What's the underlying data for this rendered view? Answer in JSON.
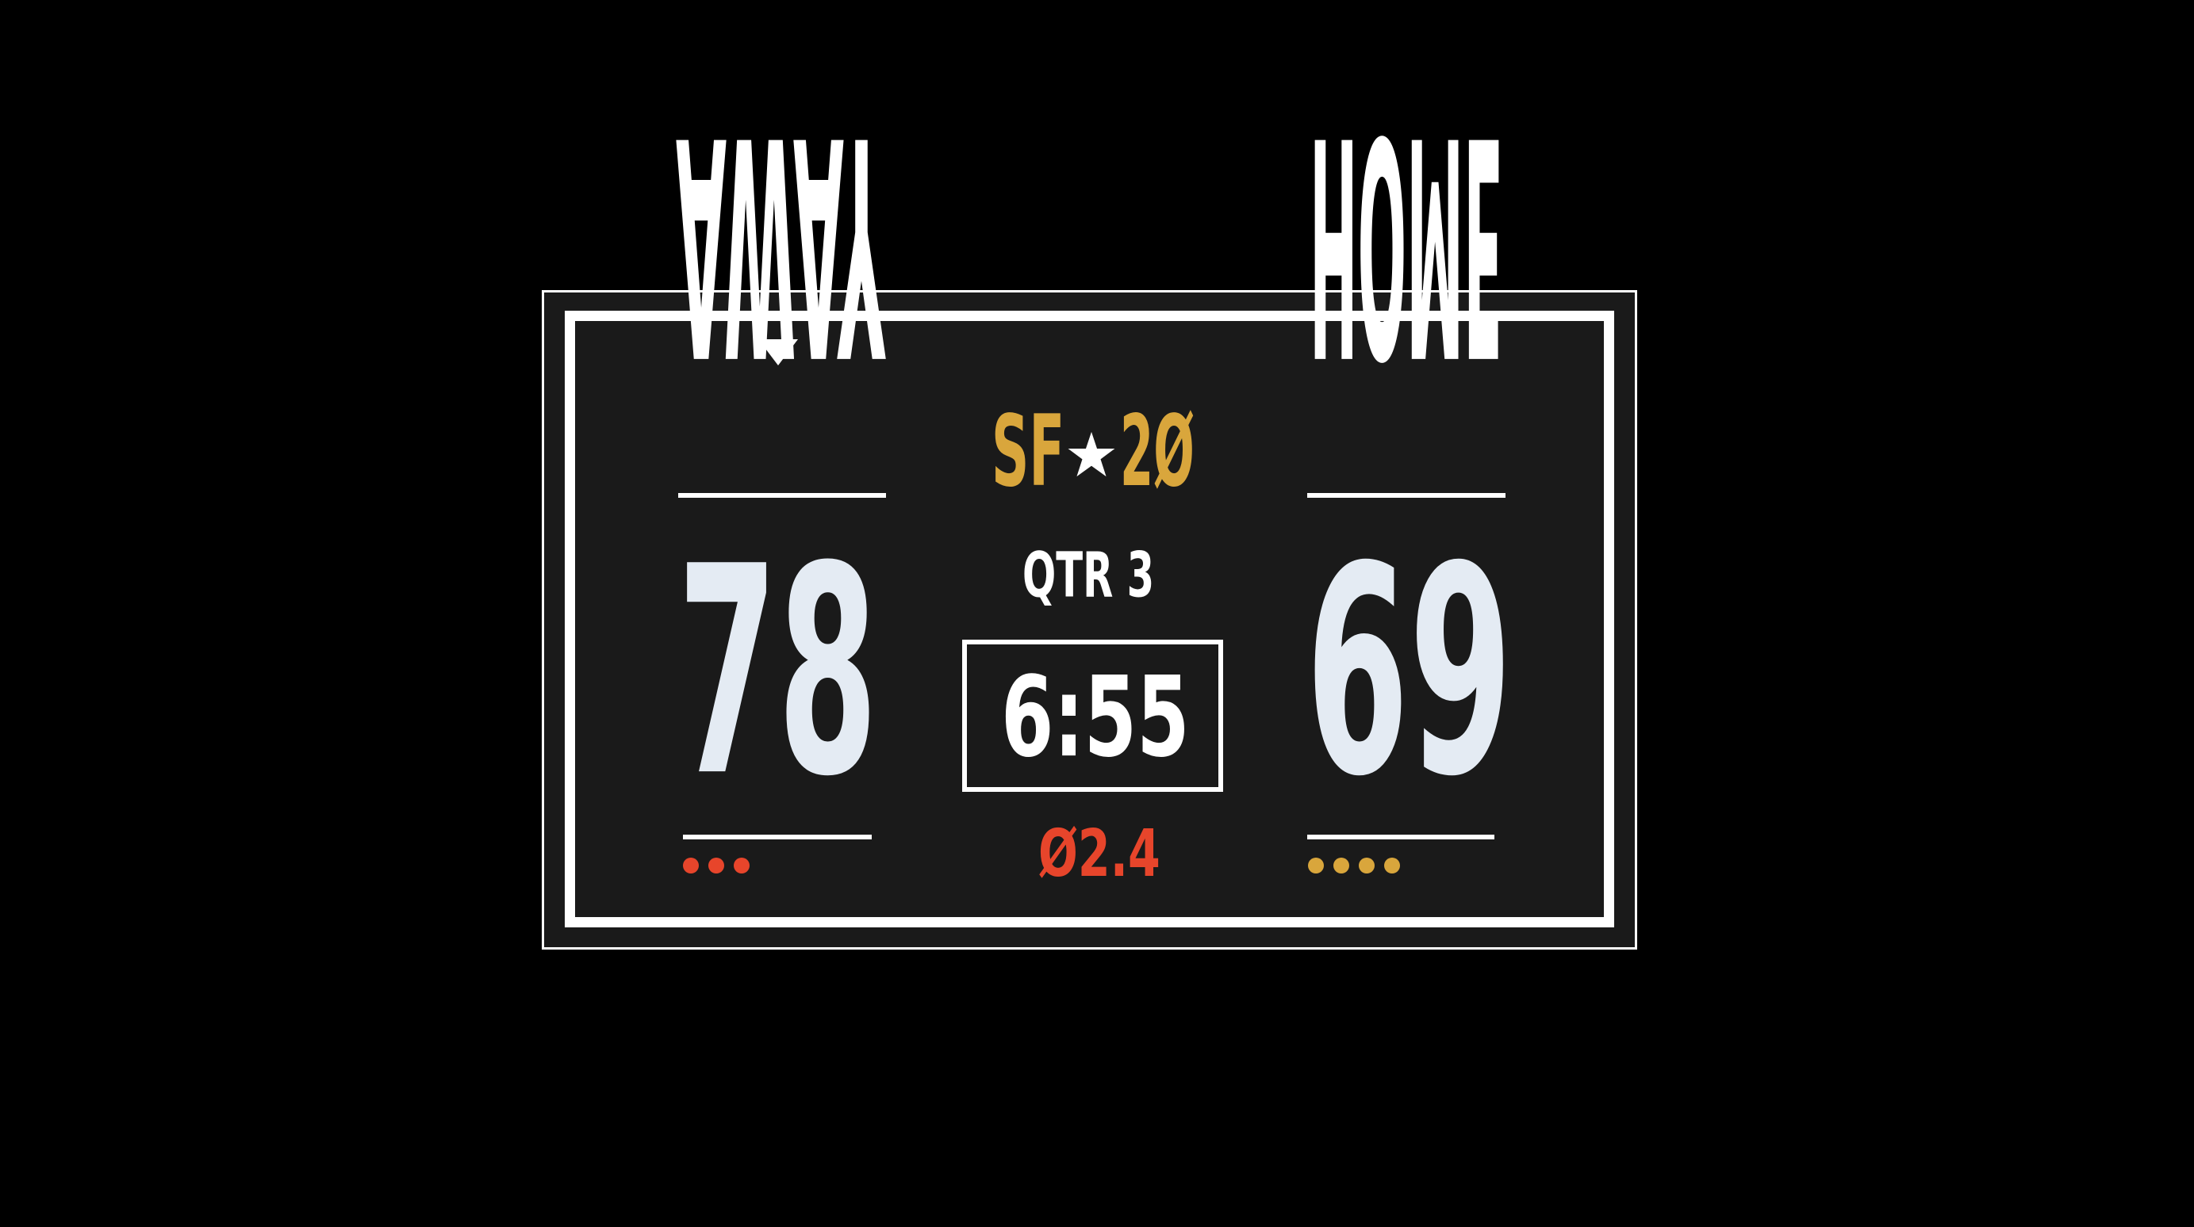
{
  "away": {
    "label": "AWAY",
    "score": "78",
    "fouls": 3,
    "possession": true,
    "dot_color": "#e7452b"
  },
  "home": {
    "label": "HOME",
    "score": "69",
    "fouls": 4,
    "possession": false,
    "dot_color": "#d9a63c"
  },
  "brand": {
    "left": "SF",
    "right": "2Ø",
    "icon": "star-icon"
  },
  "game": {
    "quarter": "QTR 3",
    "clock": "6:55",
    "shot_clock": "Ø2.4"
  },
  "colors": {
    "background": "#000000",
    "board": "#1a1a1a",
    "text": "#ffffff",
    "score": "#e4ebf3",
    "accent_gold": "#d9a63c",
    "accent_red": "#e7452b"
  }
}
